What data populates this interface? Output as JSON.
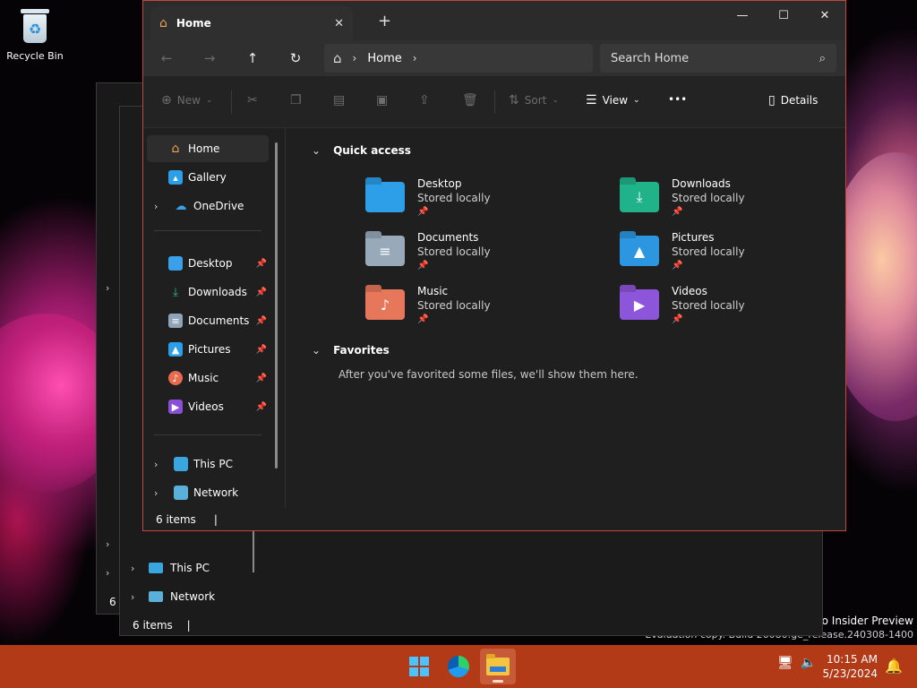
{
  "desktop": {
    "recycle_bin_label": "Recycle Bin",
    "watermark_line1": "Pro Insider Preview",
    "watermark_line2": "Evaluation copy. Build 26080.ge_release.240308-1400"
  },
  "background_windows": {
    "nav": [
      {
        "label": "This PC",
        "icon": "computer-icon"
      },
      {
        "label": "Network",
        "icon": "network-icon"
      }
    ],
    "status_items": "6 items",
    "status_partial": "6"
  },
  "window": {
    "tab": {
      "label": "Home",
      "close": "✕",
      "new_tab": "+"
    },
    "controls": {
      "minimize": "—",
      "maximize": "☐",
      "close": "✕"
    },
    "address": {
      "breadcrumb": "Home",
      "search_placeholder": "Search Home"
    },
    "command_bar": {
      "new_label": "New",
      "sort_label": "Sort",
      "view_label": "View",
      "more_label": "•••",
      "details_label": "Details"
    },
    "sidebar": {
      "top": [
        {
          "label": "Home",
          "icon": "home-icon",
          "selected": true
        },
        {
          "label": "Gallery",
          "icon": "gallery-icon"
        },
        {
          "label": "OneDrive",
          "icon": "onedrive-icon",
          "expandable": true
        }
      ],
      "pinned": [
        {
          "label": "Desktop",
          "icon": "desktop-folder-icon",
          "color": "#3aa0e8"
        },
        {
          "label": "Downloads",
          "icon": "download-icon",
          "color": "#2bbf8f"
        },
        {
          "label": "Documents",
          "icon": "documents-icon",
          "color": "#8fa4b8"
        },
        {
          "label": "Pictures",
          "icon": "pictures-icon",
          "color": "#2d9ee8"
        },
        {
          "label": "Music",
          "icon": "music-icon",
          "color": "#e86a4f"
        },
        {
          "label": "Videos",
          "icon": "videos-icon",
          "color": "#8b4fd6"
        }
      ],
      "bottom": [
        {
          "label": "This PC",
          "icon": "computer-icon"
        },
        {
          "label": "Network",
          "icon": "network-icon"
        }
      ]
    },
    "content": {
      "quick_access_title": "Quick access",
      "quick_access": [
        {
          "name": "Desktop",
          "sub": "Stored locally",
          "icon": "desktop-folder-icon",
          "color": "#2d9ee8"
        },
        {
          "name": "Downloads",
          "sub": "Stored locally",
          "icon": "downloads-folder-icon",
          "color": "#20b38a"
        },
        {
          "name": "Documents",
          "sub": "Stored locally",
          "icon": "documents-folder-icon",
          "color": "#98a9ba"
        },
        {
          "name": "Pictures",
          "sub": "Stored locally",
          "icon": "pictures-folder-icon",
          "color": "#2c97e0"
        },
        {
          "name": "Music",
          "sub": "Stored locally",
          "icon": "music-folder-icon",
          "color": "#e7775b"
        },
        {
          "name": "Videos",
          "sub": "Stored locally",
          "icon": "videos-folder-icon",
          "color": "#8d55d9"
        }
      ],
      "favorites_title": "Favorites",
      "favorites_empty": "After you've favorited some files, we'll show them here."
    },
    "status": {
      "items": "6 items"
    }
  },
  "taskbar": {
    "time": "10:15 AM",
    "date": "5/23/2024",
    "accent": "#b23a17"
  }
}
